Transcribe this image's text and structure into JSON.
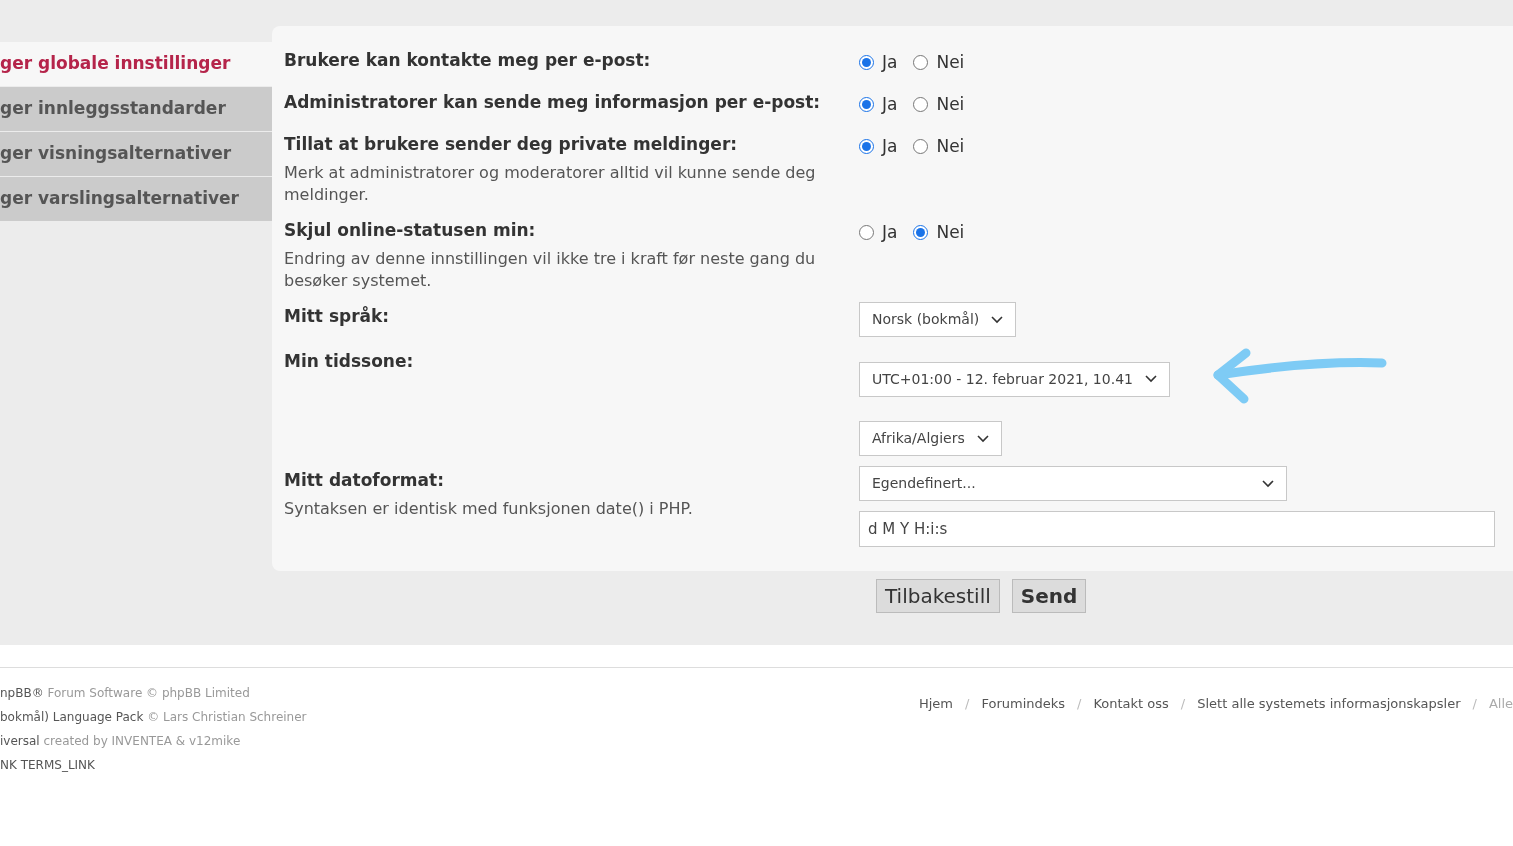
{
  "sidebar": {
    "items": [
      {
        "label": "ger globale innstillinger",
        "selected": true
      },
      {
        "label": "ger innleggsstandarder",
        "selected": false
      },
      {
        "label": "ger visningsalternativer",
        "selected": false
      },
      {
        "label": "ger varslingsalternativer",
        "selected": false
      }
    ]
  },
  "settings": [
    {
      "kind": "radio",
      "label": "Brukere kan kontakte meg per e-post:",
      "options": [
        {
          "label": "Ja",
          "selected": true
        },
        {
          "label": "Nei",
          "selected": false
        }
      ]
    },
    {
      "kind": "radio",
      "label": "Administratorer kan sende meg informasjon per e-post:",
      "options": [
        {
          "label": "Ja",
          "selected": true
        },
        {
          "label": "Nei",
          "selected": false
        }
      ]
    },
    {
      "kind": "radio",
      "label": "Tillat at brukere sender deg private meldinger:",
      "hint": "Merk at administratorer og moderatorer alltid vil kunne sende deg meldinger.",
      "options": [
        {
          "label": "Ja",
          "selected": true
        },
        {
          "label": "Nei",
          "selected": false
        }
      ]
    },
    {
      "kind": "radio",
      "label": "Skjul online-statusen min:",
      "hint": "Endring av denne innstillingen vil ikke tre i kraft før neste gang du besøker systemet.",
      "options": [
        {
          "label": "Ja",
          "selected": false
        },
        {
          "label": "Nei",
          "selected": true
        }
      ]
    },
    {
      "kind": "select",
      "label": "Mitt språk:",
      "selects": [
        "Norsk (bokmål)"
      ]
    },
    {
      "kind": "select",
      "label": "Min tidssone:",
      "selects": [
        "UTC+01:00 - 12. februar 2021, 10.41",
        "Afrika/Algiers"
      ],
      "annotated": true
    },
    {
      "kind": "date",
      "label": "Mitt datoformat:",
      "hint": "Syntaksen er identisk med funksjonen date() i PHP.",
      "selects": [
        "Egendefinert..."
      ],
      "value": "d M Y H:i:s"
    }
  ],
  "buttons": [
    {
      "label": "Tilbakestill",
      "primary": false
    },
    {
      "label": "Send",
      "primary": true
    }
  ],
  "footer": {
    "credits": [
      {
        "link": "npBB®",
        "text": " Forum Software © phpBB Limited"
      },
      {
        "link": "bokmål) Language Pack",
        "text": " © Lars Christian Schreiner"
      },
      {
        "link": "iversal",
        "text": " created by INVENTEA & v12mike"
      },
      {
        "link": "NK TERMS_LINK"
      }
    ],
    "separator": "/",
    "links": [
      "Hjem",
      "Forumindeks",
      "Kontakt oss",
      "Slett alle systemets informasjonskapsler",
      "Alle"
    ]
  }
}
